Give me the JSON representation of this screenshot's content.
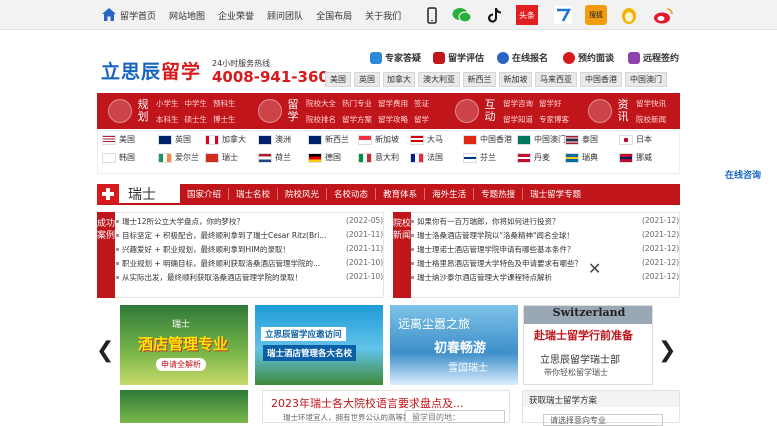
{
  "topnav": [
    "留学首页",
    "网站地图",
    "企业荣誉",
    "顾问团队",
    "全国布局",
    "关于我们"
  ],
  "social_icons": [
    "phone-icon",
    "wechat-icon",
    "tiktok-icon",
    "toutiao-icon",
    "zhihu-icon",
    "sohu-icon",
    "penguin-icon",
    "weibo-icon"
  ],
  "social_labels": {
    "toutiao": "头条",
    "sohu": "搜狐"
  },
  "logo": {
    "part1": "立思辰",
    "part2": "留学"
  },
  "hotline": {
    "label": "24小时服务热线",
    "number": "4008-941-360"
  },
  "quick_links": [
    "专家答疑",
    "留学评估",
    "在线报名",
    "预约面谈",
    "远程签约"
  ],
  "country_buttons": [
    "美国",
    "英国",
    "加拿大",
    "澳大利亚",
    "新西兰",
    "新加坡",
    "马来西亚",
    "中国香港",
    "中国澳门"
  ],
  "redband": {
    "plan": {
      "title": "规划",
      "links": [
        "小学生",
        "中学生",
        "预科生",
        "本科生",
        "硕士生",
        "博士生"
      ]
    },
    "study": {
      "title": "留学",
      "links": [
        "院校大全",
        "热门专业",
        "留学费用",
        "签证",
        "院校排名",
        "留学方案",
        "留学攻略",
        "留学"
      ]
    },
    "interact": {
      "title": "互动",
      "links": [
        "留学咨询",
        "留学好",
        "留学知道",
        "专家博客"
      ]
    },
    "info": {
      "title": "资讯",
      "links": [
        "留学快讯",
        "院校新闻"
      ]
    }
  },
  "flags_row1": [
    "美国",
    "英国",
    "加拿大",
    "澳洲",
    "新西兰",
    "新加坡",
    "大马",
    "中国香港",
    "中国澳门",
    "泰国",
    "日本"
  ],
  "flags_row2": [
    "韩国",
    "爱尔兰",
    "瑞士",
    "荷兰",
    "德国",
    "意大利",
    "法国",
    "芬兰",
    "丹麦",
    "瑞典",
    "挪威"
  ],
  "online_consult": "在线咨询",
  "country": {
    "name": "瑞士",
    "tabs": [
      "国家介绍",
      "瑞士名校",
      "院校风光",
      "名校动态",
      "教育体系",
      "海外生活",
      "专题热搜",
      "瑞士留学专题"
    ]
  },
  "success_cases": {
    "label": "成功案例",
    "items": [
      {
        "title": "瑞士12所公立大学盘点，你的梦校？",
        "date": "(2022-05)"
      },
      {
        "title": "目标坚定 + 积极配合，最终顺利拿到了瑞士Cesar Ritz(Bri...",
        "date": "(2021-11)"
      },
      {
        "title": "兴趣爱好 + 职业规划，最终顺利拿到HIM的录取！",
        "date": "(2021-11)"
      },
      {
        "title": "职业规划 + 明确目标，最终顺利获取洛桑酒店管理学院的...",
        "date": "(2021-10)"
      },
      {
        "title": "从实际出发，最终顺利获取洛桑酒店管理学院的录取！",
        "date": "(2021-10)"
      }
    ]
  },
  "school_news": {
    "label": "院校新闻",
    "items": [
      {
        "title": "如果你有一百万瑞郎，你将如何进行投资？",
        "date": "(2021-12)"
      },
      {
        "title": "瑞士洛桑酒店管理学院以\"洛桑精神\"闻名全球！",
        "date": "(2021-12)"
      },
      {
        "title": "瑞士理诺士酒店管理学院申请有哪些基本条件？",
        "date": "(2021-12)"
      },
      {
        "title": "瑞士格里昂酒店管理大学特色及申请要求有哪些？",
        "date": "(2021-12)"
      },
      {
        "title": "瑞士纳沙泰尔酒店管理大学课程特点解析",
        "date": "(2021-12)"
      }
    ]
  },
  "banners": [
    {
      "line1": "瑞士",
      "line2": "酒店管理专业",
      "line3": "申请全解析"
    },
    {
      "line1": "立思辰留学应邀访问",
      "line2": "瑞士酒店管理各大名校"
    },
    {
      "line1": "远离尘嚣之旅",
      "line2": "初春畅游",
      "line3": "雪国瑞士"
    },
    {
      "line1": "Switzerland",
      "line2": "赴瑞士留学行前准备",
      "line3": "立思辰留学瑞士部",
      "line4": "带你轻松留学瑞士"
    }
  ],
  "bottom": {
    "headline": "2023年瑞士各大院校语言要求盘点及...",
    "subtext": "瑞士环境宜人，拥有世界公认的高等教",
    "form_placeholder": "留学目的地：",
    "form_title": "获取瑞士留学方案",
    "select_placeholder": "请选择意向专业"
  },
  "colors": {
    "brand_red": "#c0151b",
    "brand_blue": "#1565c0"
  }
}
